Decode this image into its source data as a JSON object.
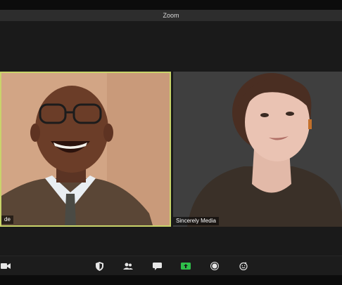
{
  "window": {
    "title": "Zoom"
  },
  "participants": [
    {
      "name": "de"
    },
    {
      "name": "Sincerely Media"
    }
  ],
  "colors": {
    "active_speaker_border": "#c9d46a",
    "share_button": "#2fbf4a",
    "icon": "#e6e6e6"
  },
  "toolbar": {
    "icons": [
      "video-camera-icon",
      "security-shield-icon",
      "participants-icon",
      "chat-icon",
      "share-screen-icon",
      "record-icon",
      "reactions-icon"
    ]
  }
}
